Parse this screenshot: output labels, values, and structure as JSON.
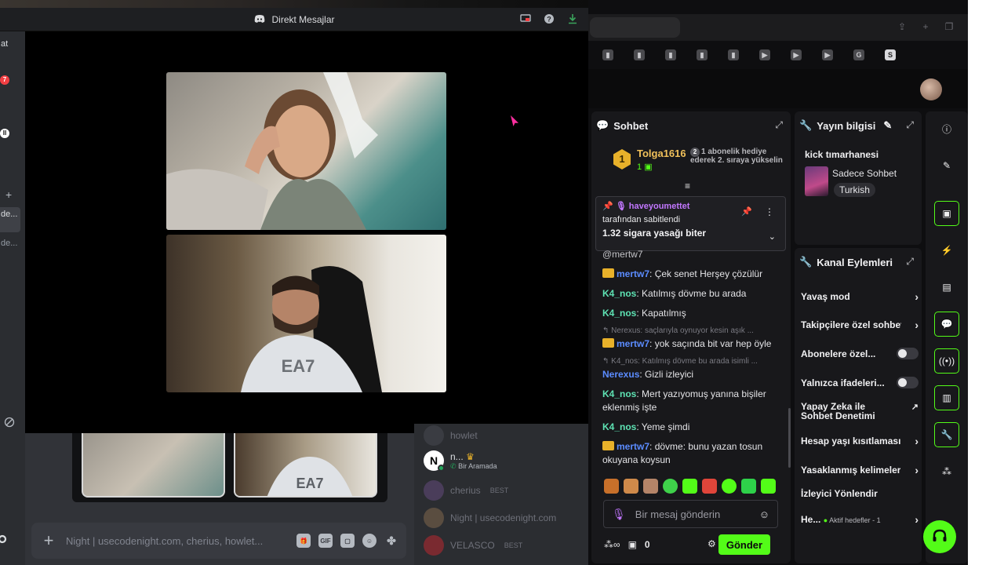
{
  "discord": {
    "window_title": "Direkt Mesajlar",
    "rail": {
      "item1": "at",
      "badge1": "7",
      "badge2": "II",
      "plus": "+",
      "item2": "de...",
      "item3": "de..."
    },
    "input_placeholder": "Night | usecodenight.com, cherius, howlet...",
    "input_icons": [
      "gift-icon",
      "gif-icon",
      "sticker-icon",
      "emoji-icon",
      "apps-icon"
    ],
    "gif_label": "GIF",
    "members": [
      {
        "name": "howlet",
        "tag": ""
      },
      {
        "name": "n...",
        "status": "Bir Aramada",
        "tag": ""
      },
      {
        "name": "cherius",
        "tag": "BEST"
      },
      {
        "name": "Night | usecodenight.com",
        "tag": ""
      },
      {
        "name": "VELASCO",
        "tag": "BEST"
      }
    ],
    "member_avatar_letter": "N"
  },
  "kick": {
    "chat": {
      "title": "Sohbet",
      "leader": {
        "rank": "1",
        "name": "Tolga1616",
        "count": "1",
        "message_num": "2",
        "message": "1 abonelik hediye ederek 2. sıraya yükselin"
      },
      "pinned": {
        "user": "haveyoumettet",
        "by": "tarafından sabitlendi",
        "text": "1.32 sigara yasağı biter"
      },
      "partial_line": "@mertw7",
      "messages": [
        {
          "user": "mertw7",
          "text": ": Çek senet Herşey çözülür",
          "crown": true,
          "color": "blue"
        },
        {
          "user": "K4_nos",
          "text": ": Katılmış dövme bu arada",
          "crown": false,
          "color": "green"
        },
        {
          "user": "K4_nos",
          "text": ": Kapatılmış",
          "crown": false,
          "color": "green"
        },
        {
          "reply": "Nerexus: saçlarıyla oynuyor kesin aşık ..."
        },
        {
          "user": "mertw7",
          "text": ": yok saçında bit var hep öyle",
          "crown": true,
          "color": "blue"
        },
        {
          "reply": "K4_nos: Katılmış dövme bu arada isimli ..."
        },
        {
          "user": "Nerexus",
          "text": ": Gizli izleyici",
          "crown": false,
          "color": "blue"
        },
        {
          "user": "K4_nos",
          "text": ": Mert yazıyomuş yanına bişiler eklenmiş işte",
          "crown": false,
          "color": "green"
        },
        {
          "user": "K4_nos",
          "text": ": Yeme şimdi",
          "crown": false,
          "color": "green"
        },
        {
          "user": "mertw7",
          "text": ": dövme: bunu yazan tosun okuyana koysun",
          "crown": true,
          "color": "blue"
        }
      ],
      "input_placeholder": "Bir mesaj gönderin",
      "points": "0",
      "send_label": "Gönder"
    },
    "stream_info": {
      "title": "Yayın bilgisi",
      "stream_title": "kick tımarhanesi",
      "category": "Sadece Sohbet",
      "language": "Turkish"
    },
    "channel_actions": {
      "title": "Kanal Eylemleri",
      "items": [
        {
          "label": "Yavaş mod",
          "control": "chevron"
        },
        {
          "label": "Takipçilere özel sohbet",
          "control": "chevron"
        },
        {
          "label": "Abonelere özel...",
          "control": "toggle"
        },
        {
          "label": "Yalnızca ifadeleri...",
          "control": "toggle"
        },
        {
          "label": "Yapay Zeka ile Sohbet Denetimi",
          "control": "external"
        },
        {
          "label": "Hesap yaşı kısıtlaması",
          "control": "chevron"
        },
        {
          "label": "Yasaklanmış kelimeler",
          "control": "chevron"
        },
        {
          "label": "İzleyici Yönlendir",
          "control": "none"
        },
        {
          "label": "He...",
          "sub": "Aktif hedefler - 1",
          "control": "chevron"
        }
      ]
    },
    "sidebar_icons": [
      "info-icon",
      "edit-icon",
      "screen-icon",
      "bolt-icon",
      "notes-icon",
      "chat-icon",
      "broadcast-icon",
      "layout-icon",
      "wrench-icon",
      "apps-icon"
    ]
  },
  "colors": {
    "kick_green": "#53fc18",
    "discord_bg": "#1e1f22",
    "gold": "#e8b12a"
  }
}
